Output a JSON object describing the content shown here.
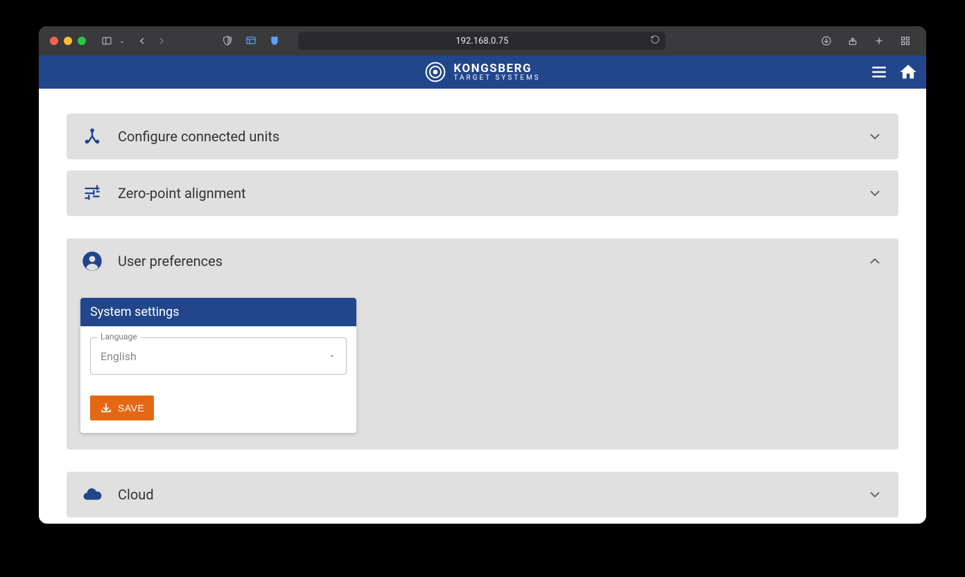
{
  "browser": {
    "url": "192.168.0.75"
  },
  "brand": {
    "line1": "KONGSBERG",
    "line2": "TARGET SYSTEMS"
  },
  "accordions": {
    "configure": {
      "title": "Configure connected units"
    },
    "zero": {
      "title": "Zero-point alignment"
    },
    "userprefs": {
      "title": "User preferences"
    },
    "cloud": {
      "title": "Cloud"
    }
  },
  "card": {
    "header": "System settings",
    "languageLabel": "Language",
    "languageValue": "English",
    "saveLabel": "SAVE"
  }
}
